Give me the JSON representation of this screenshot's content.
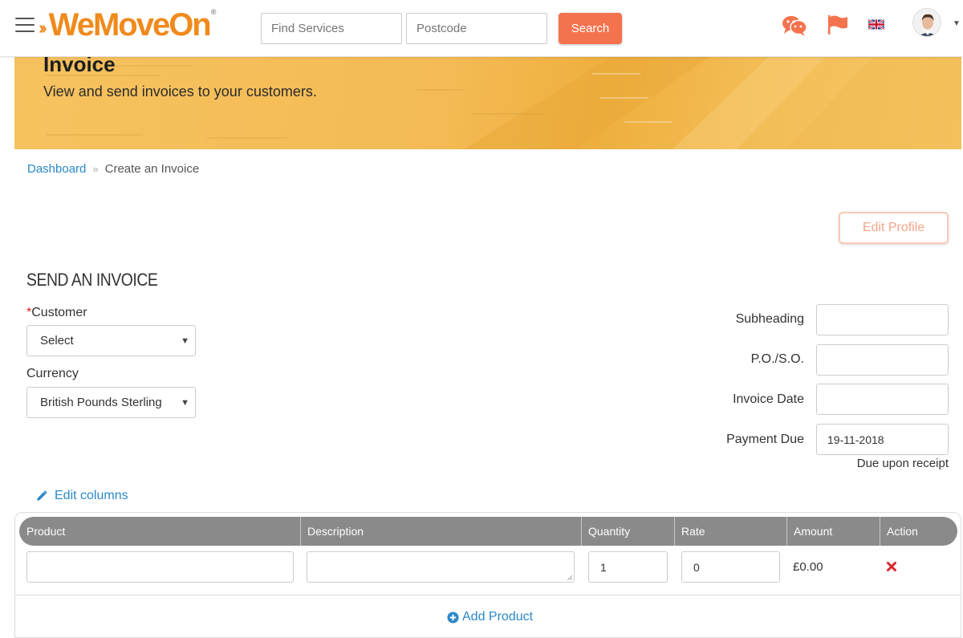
{
  "header": {
    "logo": {
      "we": "We",
      "move": "Move",
      "on": "On",
      "reg": "®"
    },
    "search": {
      "services_placeholder": "Find Services",
      "postcode_placeholder": "Postcode",
      "button_label": "Search"
    },
    "icons": [
      "hamburger-menu-icon",
      "chat-icon",
      "flag-icon",
      "uk-flag-icon",
      "user-avatar",
      "chevron-down-icon"
    ]
  },
  "banner": {
    "title": "Invoice",
    "subtitle": "View and send invoices to your customers."
  },
  "breadcrumb": {
    "home": "Dashboard",
    "separator": "»",
    "current": "Create an Invoice"
  },
  "edit_profile_label": "Edit Profile",
  "form": {
    "title": "SEND AN INVOICE",
    "customer": {
      "required_mark": "*",
      "label": "Customer",
      "value": "Select"
    },
    "currency": {
      "label": "Currency",
      "value": "British Pounds Sterling"
    },
    "subheading": {
      "label": "Subheading",
      "value": ""
    },
    "po_so": {
      "label": "P.O./S.O.",
      "value": ""
    },
    "invoice_date": {
      "label": "Invoice Date",
      "value": ""
    },
    "payment_due": {
      "label": "Payment Due",
      "value": "19-11-2018",
      "note": "Due upon receipt"
    }
  },
  "edit_columns_label": "Edit columns",
  "table": {
    "columns": [
      "Product",
      "Description",
      "Quantity",
      "Rate",
      "Amount",
      "Action"
    ],
    "rows": [
      {
        "product": "",
        "description": "",
        "quantity": "1",
        "rate": "0",
        "amount": "£0.00"
      }
    ],
    "add_product_label": "Add Product"
  },
  "colors": {
    "accent": "#f4734e",
    "brand": "#f08a1c",
    "link": "#2a88c8",
    "banner": "#f4bb55",
    "table_header": "#8a8a8a"
  }
}
